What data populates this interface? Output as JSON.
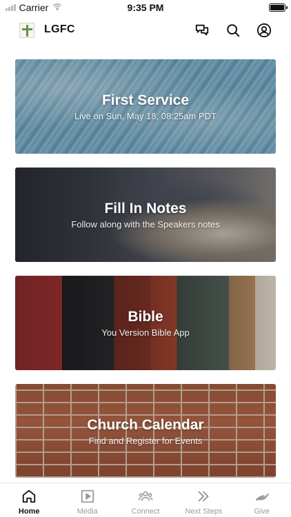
{
  "status_bar": {
    "carrier": "Carrier",
    "time": "9:35 PM"
  },
  "header": {
    "title": "LGFC",
    "icons": [
      "chat-icon",
      "search-icon",
      "account-icon"
    ]
  },
  "cards": [
    {
      "title": "First Service",
      "subtitle": "Live on Sun, May 18, 08:25am PDT"
    },
    {
      "title": "Fill In Notes",
      "subtitle": "Follow along with the Speakers notes"
    },
    {
      "title": "Bible",
      "subtitle": "You Version Bible App"
    },
    {
      "title": "Church Calendar",
      "subtitle": "Find and Register for Events"
    }
  ],
  "tab_bar": {
    "active": "Home",
    "tabs": [
      {
        "label": "Home",
        "icon": "home-icon"
      },
      {
        "label": "Media",
        "icon": "media-icon"
      },
      {
        "label": "Connect",
        "icon": "connect-icon"
      },
      {
        "label": "Next Steps",
        "icon": "next-steps-icon"
      },
      {
        "label": "Give",
        "icon": "give-icon"
      }
    ]
  },
  "colors": {
    "active_tab": "#111111",
    "inactive_tab": "#9a9a9a",
    "card_text": "#ffffff"
  }
}
